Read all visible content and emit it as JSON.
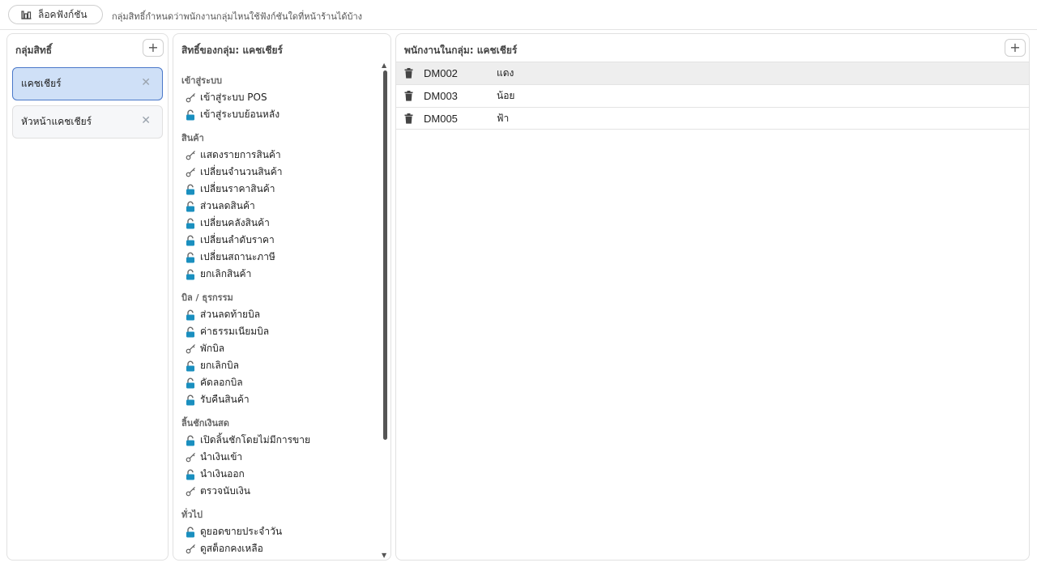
{
  "topbar": {
    "lock_label": "ล็อคฟังก์ชัน",
    "description": "กลุ่มสิทธิ์กำหนดว่าพนักงานกลุ่มไหนใช้ฟังก์ชันใดที่หน้าร้านได้บ้าง"
  },
  "groups_panel": {
    "title": "กลุ่มสิทธิ์",
    "add_label": "+",
    "items": [
      {
        "label": "แคชเชียร์",
        "selected": true
      },
      {
        "label": "หัวหน้าแคชเชียร์",
        "selected": false
      }
    ]
  },
  "perms_panel": {
    "title": "สิทธิ์ของกลุ่ม: แคชเชียร์",
    "categories": [
      {
        "name": "เข้าสู่ระบบ",
        "items": [
          {
            "label": "เข้าสู่ระบบ POS",
            "icon": "key"
          },
          {
            "label": "เข้าสู่ระบบย้อนหลัง",
            "icon": "lock"
          }
        ]
      },
      {
        "name": "สินค้า",
        "items": [
          {
            "label": "แสดงรายการสินค้า",
            "icon": "key"
          },
          {
            "label": "เปลี่ยนจำนวนสินค้า",
            "icon": "key"
          },
          {
            "label": "เปลี่ยนราคาสินค้า",
            "icon": "lock"
          },
          {
            "label": "ส่วนลดสินค้า",
            "icon": "lock"
          },
          {
            "label": "เปลี่ยนคลังสินค้า",
            "icon": "lock"
          },
          {
            "label": "เปลี่ยนลำดับราคา",
            "icon": "lock"
          },
          {
            "label": "เปลี่ยนสถานะภาษี",
            "icon": "lock"
          },
          {
            "label": "ยกเลิกสินค้า",
            "icon": "lock"
          }
        ]
      },
      {
        "name": "บิล / ธุรกรรม",
        "items": [
          {
            "label": "ส่วนลดท้ายบิล",
            "icon": "lock"
          },
          {
            "label": "ค่าธรรมเนียมบิล",
            "icon": "lock"
          },
          {
            "label": "พักบิล",
            "icon": "key"
          },
          {
            "label": "ยกเลิกบิล",
            "icon": "lock"
          },
          {
            "label": "คัดลอกบิล",
            "icon": "lock"
          },
          {
            "label": "รับคืนสินค้า",
            "icon": "lock"
          }
        ]
      },
      {
        "name": "ลิ้นชักเงินสด",
        "items": [
          {
            "label": "เปิดลิ้นชักโดยไม่มีการขาย",
            "icon": "lock"
          },
          {
            "label": "นำเงินเข้า",
            "icon": "key"
          },
          {
            "label": "นำเงินออก",
            "icon": "lock"
          },
          {
            "label": "ตรวจนับเงิน",
            "icon": "key"
          }
        ]
      },
      {
        "name": "ทั่วไป",
        "items": [
          {
            "label": "ดูยอดขายประจำวัน",
            "icon": "lock"
          },
          {
            "label": "ดูสต็อกคงเหลือ",
            "icon": "key"
          }
        ]
      }
    ]
  },
  "emps_panel": {
    "title": "พนักงานในกลุ่ม: แคชเชียร์",
    "add_label": "+",
    "rows": [
      {
        "code": "DM002",
        "name": "แดง"
      },
      {
        "code": "DM003",
        "name": "น้อย"
      },
      {
        "code": "DM005",
        "name": "ฟ้า"
      }
    ]
  },
  "colors": {
    "lock_icon": "#1a8fbf",
    "selected_bg": "#cfe0f7",
    "selected_border": "#4a78c9"
  }
}
